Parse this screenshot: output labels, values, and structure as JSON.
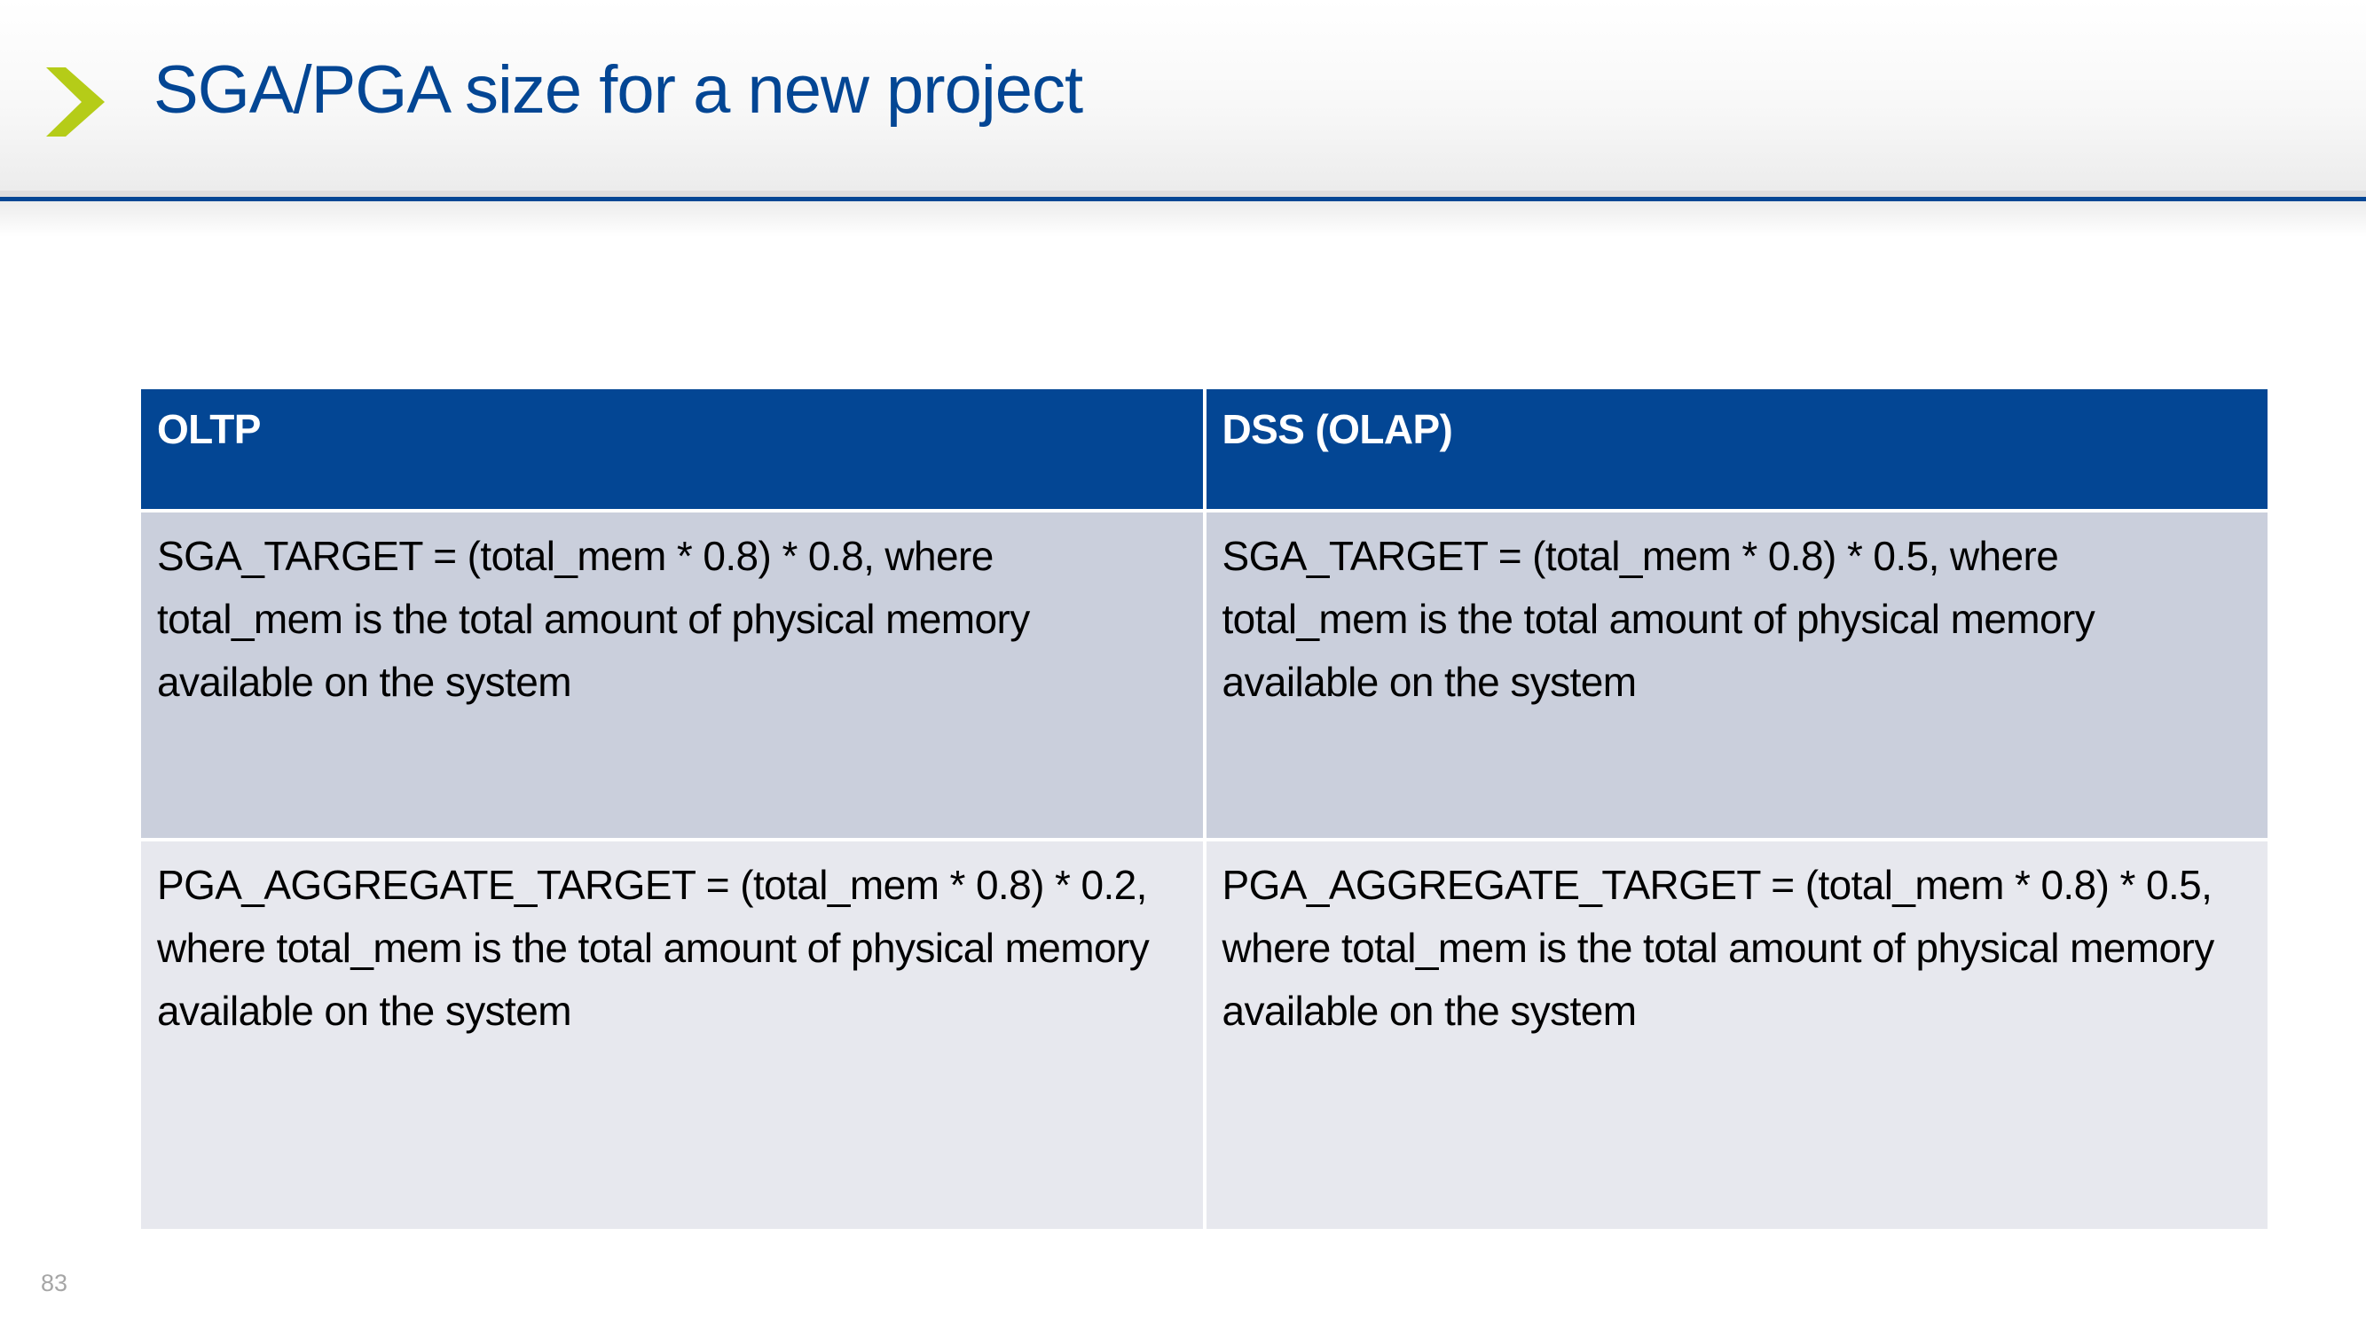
{
  "slide": {
    "title": "SGA/PGA size for a new project",
    "page_number": "83",
    "accent_color": "#034694",
    "chevron_color": "#b5cc18"
  },
  "table": {
    "headers": [
      "OLTP",
      "DSS (OLAP)"
    ],
    "rows": [
      [
        "SGA_TARGET = (total_mem * 0.8) * 0.8, where total_mem is the total amount of physical memory available on the system",
        "SGA_TARGET = (total_mem * 0.8) * 0.5, where total_mem is the total amount of physical memory available on the system"
      ],
      [
        "PGA_AGGREGATE_TARGET = (total_mem * 0.8) * 0.2, where total_mem is the total amount of physical memory available on the system",
        "PGA_AGGREGATE_TARGET = (total_mem * 0.8) * 0.5, where total_mem is the total amount of physical memory available on the system"
      ]
    ]
  }
}
